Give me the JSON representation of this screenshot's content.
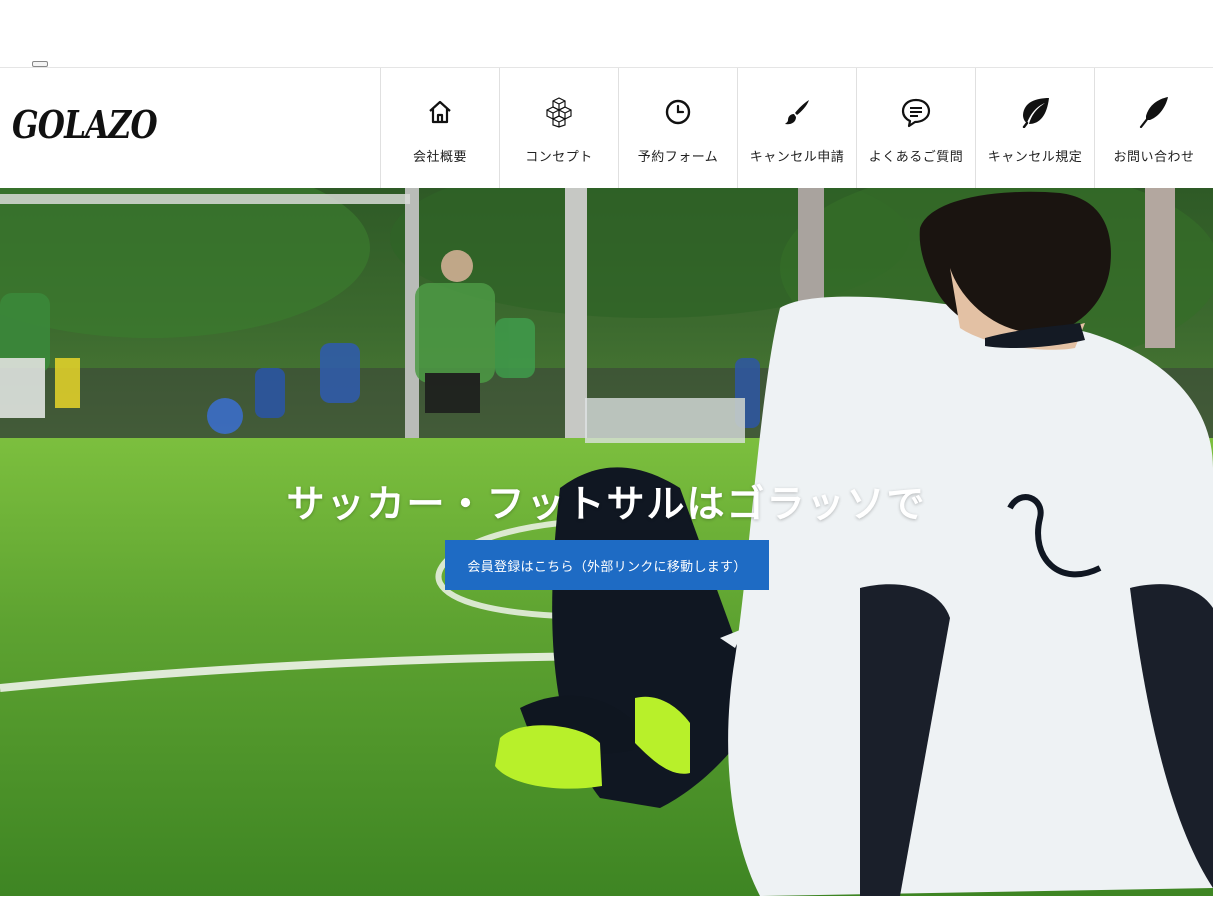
{
  "site": {
    "logo_text": "GOLAZO"
  },
  "nav": {
    "items": [
      {
        "label": "会社概要",
        "icon": "home-icon"
      },
      {
        "label": "コンセプト",
        "icon": "cubes-icon"
      },
      {
        "label": "予約フォーム",
        "icon": "clock-icon"
      },
      {
        "label": "キャンセル申請",
        "icon": "brush-icon"
      },
      {
        "label": "よくあるご質問",
        "icon": "chat-bubble-icon"
      },
      {
        "label": "キャンセル規定",
        "icon": "leaf-icon"
      },
      {
        "label": "お問い合わせ",
        "icon": "feather-icon"
      }
    ]
  },
  "hero": {
    "title": "サッカー・フットサルはゴラッソで",
    "button_label": "会員登録はこちら（外部リンクに移動します）",
    "button_color": "#1e6bc4"
  }
}
